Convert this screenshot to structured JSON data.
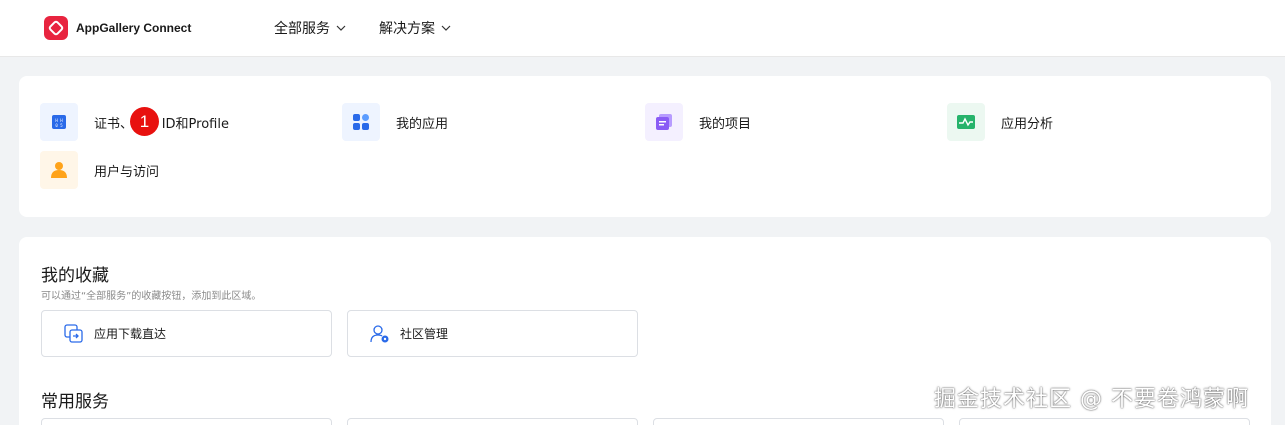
{
  "header": {
    "brand": "AppGallery Connect",
    "nav": [
      {
        "label": "全部服务"
      },
      {
        "label": "解决方案"
      }
    ]
  },
  "quick_links": [
    {
      "label": "证书、APP ID和Profile",
      "icon": "certificate-icon"
    },
    {
      "label": "我的应用",
      "icon": "apps-grid-icon"
    },
    {
      "label": "我的项目",
      "icon": "project-icon"
    },
    {
      "label": "应用分析",
      "icon": "analytics-icon"
    },
    {
      "label": "用户与访问",
      "icon": "user-icon"
    }
  ],
  "badge": {
    "number": "1"
  },
  "favorites": {
    "title": "我的收藏",
    "subtitle": "可以通过“全部服务”的收藏按钮，添加到此区域。",
    "items": [
      {
        "label": "应用下载直达",
        "icon": "download-redirect-icon"
      },
      {
        "label": "社区管理",
        "icon": "community-manage-icon"
      }
    ]
  },
  "common_services": {
    "title": "常用服务"
  },
  "watermark": "掘金技术社区 @ 不要卷鸿蒙啊",
  "colors": {
    "brand": "#e8243f",
    "badge": "#e8110f",
    "accent_blue": "#2a6ae9",
    "purple": "#8a5cf5",
    "green": "#26b36b",
    "orange": "#ffa31a"
  }
}
